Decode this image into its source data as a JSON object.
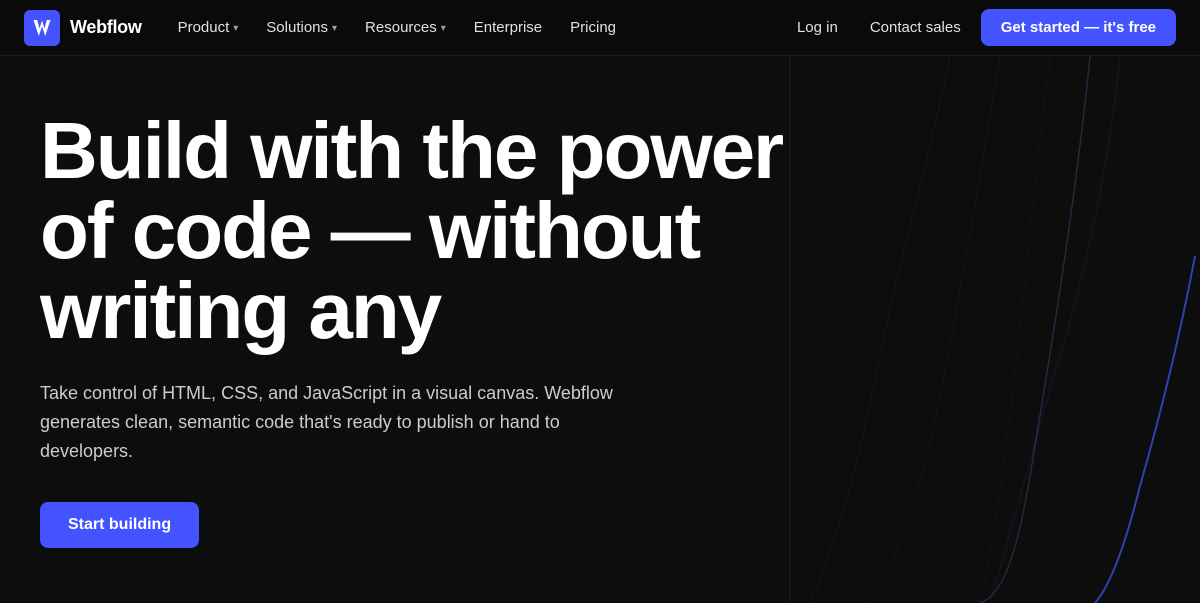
{
  "brand": {
    "name": "Webflow"
  },
  "nav": {
    "items": [
      {
        "label": "Product",
        "hasDropdown": true
      },
      {
        "label": "Solutions",
        "hasDropdown": true
      },
      {
        "label": "Resources",
        "hasDropdown": true
      },
      {
        "label": "Enterprise",
        "hasDropdown": false
      },
      {
        "label": "Pricing",
        "hasDropdown": false
      }
    ],
    "right": {
      "login": "Log in",
      "contact": "Contact sales",
      "cta": "Get started — it's free"
    }
  },
  "hero": {
    "title": "Build with the power of code — without writing any",
    "subtitle": "Take control of HTML, CSS, and JavaScript in a visual canvas. Webflow generates clean, semantic code that's ready to publish or hand to developers.",
    "cta": "Start building"
  },
  "colors": {
    "accent": "#4353ff",
    "background": "#0d0d0d",
    "text_primary": "#ffffff",
    "text_secondary": "#cccccc"
  }
}
